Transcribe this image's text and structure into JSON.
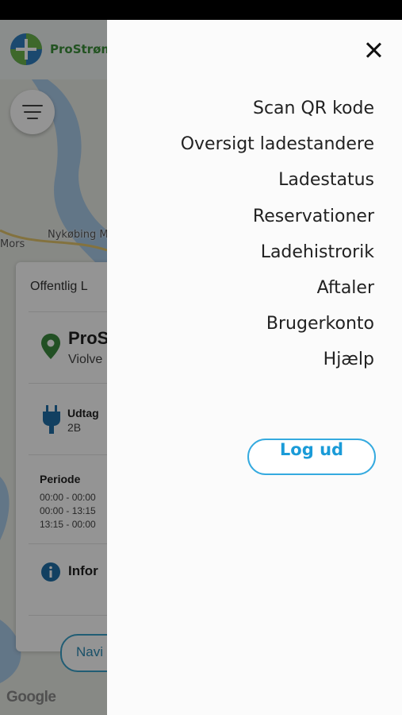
{
  "app": {
    "brand": "ProStrøm",
    "colors": {
      "brand_green": "#3b8f3a",
      "accent_blue": "#1a9bd8",
      "pin_green": "#3c8a3f",
      "plug_blue": "#1f6fa8"
    }
  },
  "map": {
    "labels": [
      "Mors",
      "Nykøbing Mors"
    ],
    "attribution": "Google"
  },
  "station_card": {
    "title": "Offentlig L",
    "name": "ProS",
    "address": "Violve",
    "outlet_label": "Udtag",
    "outlet_value": "2B",
    "period_label": "Periode",
    "periods": [
      "00:00 - 00:00",
      "00:00 - 13:15",
      "13:15 - 00:00"
    ],
    "info_label": "Infor",
    "navigate_label": "Navi"
  },
  "drawer": {
    "close_icon": "close-icon",
    "items": [
      {
        "label": "Scan QR kode"
      },
      {
        "label": "Oversigt ladestandere"
      },
      {
        "label": "Ladestatus"
      },
      {
        "label": "Reservationer"
      },
      {
        "label": "Ladehistrorik"
      },
      {
        "label": "Aftaler"
      },
      {
        "label": "Brugerkonto"
      },
      {
        "label": "Hjælp"
      }
    ],
    "logout_label": "Log ud"
  }
}
